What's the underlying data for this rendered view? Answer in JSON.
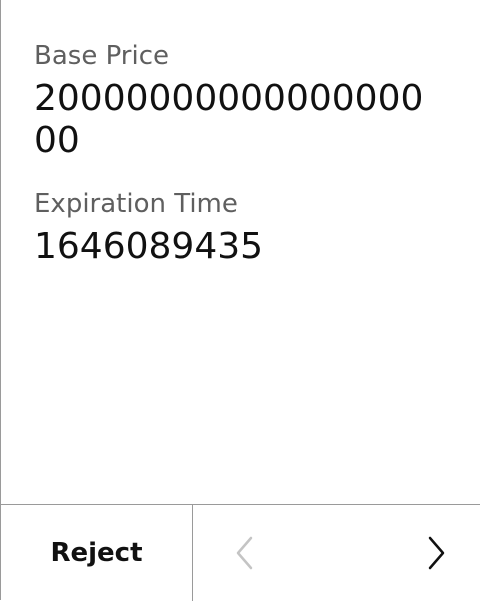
{
  "fields": [
    {
      "label": "Base Price",
      "value": "2000000000000000000"
    },
    {
      "label": "Expiration Time",
      "value": "1646089435"
    }
  ],
  "footer": {
    "reject_label": "Reject",
    "prev_icon": "chevron-left-icon",
    "next_icon": "chevron-right-icon"
  },
  "colors": {
    "label": "#5f5f5f",
    "value": "#111111",
    "divider": "#9a9a9a",
    "prev_disabled": "#c4c4c4",
    "next_enabled": "#111111"
  }
}
